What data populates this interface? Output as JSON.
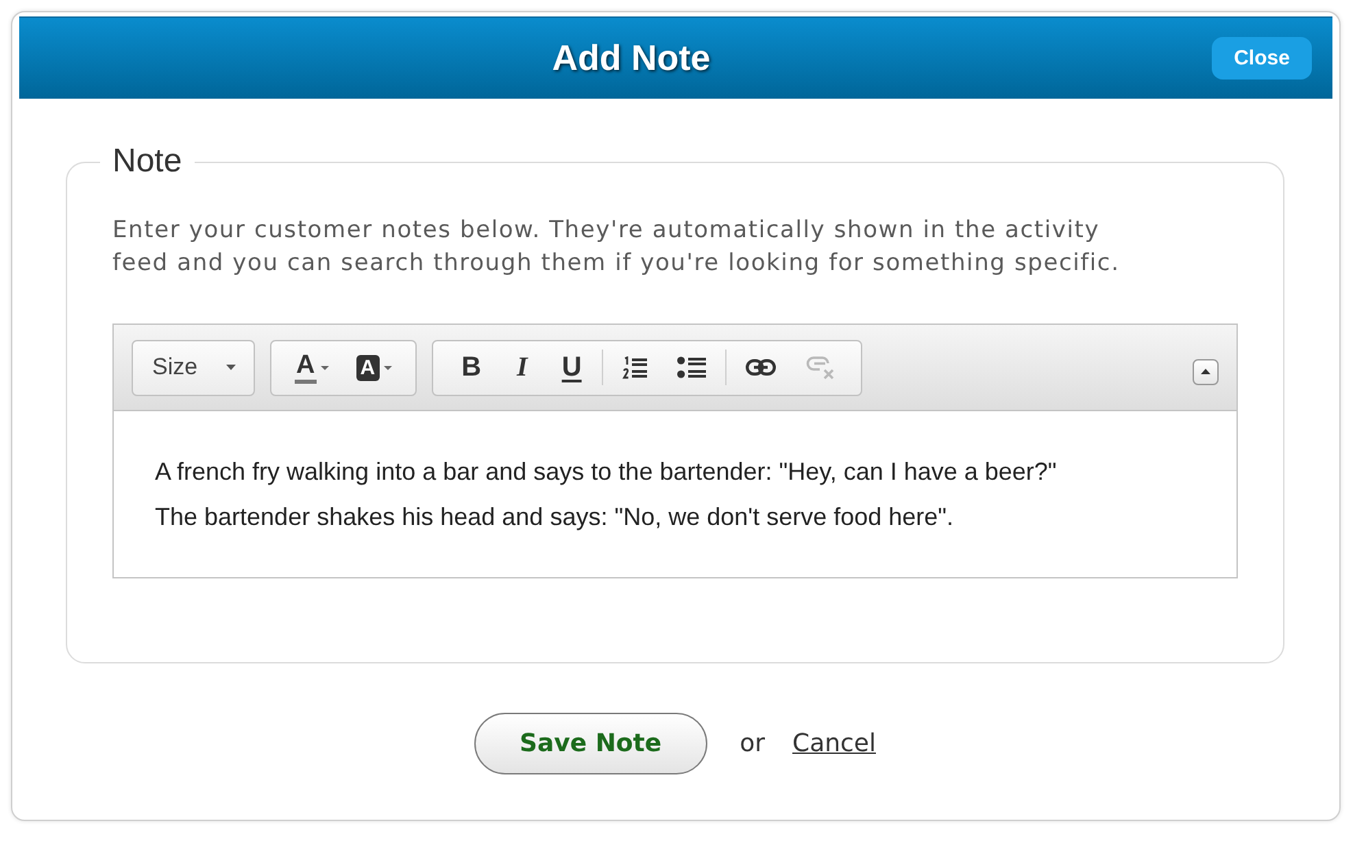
{
  "dialog": {
    "title": "Add Note",
    "close_button": "Close"
  },
  "fieldset": {
    "legend": "Note",
    "description": "Enter your customer notes below. They're automatically shown in the activity feed and you can search through them if you're looking for something specific.",
    "editor": {
      "toolbar": {
        "groups": [
          {
            "sections": [
              [
                {
                  "kind": "dropdown",
                  "label": "Size",
                  "disabled": false
                }
              ]
            ]
          },
          {
            "sections": [
              [
                {
                  "kind": "font-color",
                  "label": "A",
                  "disabled": false
                },
                {
                  "kind": "highlight-color",
                  "label": "A",
                  "disabled": false
                }
              ]
            ]
          },
          {
            "sections": [
              [
                {
                  "kind": "bold",
                  "label": "B",
                  "disabled": false
                },
                {
                  "kind": "italic",
                  "label": "I",
                  "disabled": false
                },
                {
                  "kind": "underline",
                  "label": "U",
                  "disabled": false
                }
              ],
              [
                {
                  "kind": "ordered-list",
                  "disabled": false
                },
                {
                  "kind": "bullet-list",
                  "disabled": false
                }
              ],
              [
                {
                  "kind": "link",
                  "disabled": false
                },
                {
                  "kind": "unlink",
                  "disabled": true
                }
              ]
            ]
          }
        ]
      },
      "content": "A french fry walking into a bar and says to the bartender: \"Hey, can I have a beer?\"\nThe bartender shakes his head and says: \"No, we don't serve food here\"."
    }
  },
  "actions": {
    "save_button": "Save Note",
    "separator": "or",
    "cancel_link": "Cancel"
  }
}
